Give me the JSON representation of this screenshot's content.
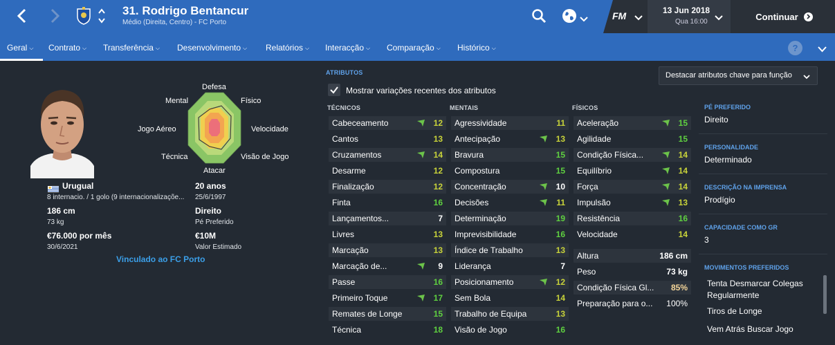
{
  "header": {
    "player_title": "31. Rodrigo Bentancur",
    "player_subtitle": "Médio (Direita, Centro) - FC Porto",
    "fm_logo": "FM",
    "date": "13 Jun 2018",
    "day_time": "Qua 16:00",
    "continue_label": "Continuar",
    "icons": [
      "back-arrow-icon",
      "forward-arrow-icon",
      "club-crest-icon",
      "up-down-chevron-icon",
      "search-icon",
      "globe-icon",
      "chevron-down-icon",
      "continue-arrow-icon"
    ]
  },
  "tabs": [
    {
      "label": "Geral"
    },
    {
      "label": "Contrato"
    },
    {
      "label": "Transferência"
    },
    {
      "label": "Desenvolvimento"
    },
    {
      "label": "Relatórios"
    },
    {
      "label": "Interacção"
    },
    {
      "label": "Comparação"
    },
    {
      "label": "Histórico"
    }
  ],
  "help_label": "?",
  "radar": {
    "labels": [
      "Defesa",
      "Mental",
      "Físico",
      "Jogo Aéreo",
      "Velocidade",
      "Técnica",
      "Visão de Jogo",
      "Atacar"
    ]
  },
  "profile": {
    "nation": "Urugual",
    "caps": "8 internacio. / 1 golo (9 internacionalizaçõe...",
    "age": "20 anos",
    "birth": "25/6/1997",
    "height": "186 cm",
    "weight": "73 kg",
    "foot": "Direito",
    "foot_label": "Pé Preferido",
    "wage": "€76.000 por mês",
    "contract_end": "30/6/2021",
    "value": "€10M",
    "value_label": "Valor Estimado",
    "club_link": "Vinculado ao FC Porto"
  },
  "attributes": {
    "section_title": "ATRIBUTOS",
    "highlight_dropdown": "Destacar atributos chave para função",
    "show_changes_label": "Mostrar variações recentes dos atributos",
    "technical_title": "TÉCNICOS",
    "mental_title": "MENTAIS",
    "physical_title": "FÍSICOS",
    "technical": [
      {
        "name": "Cabeceamento",
        "value": "12",
        "up": true
      },
      {
        "name": "Cantos",
        "value": "13",
        "up": false
      },
      {
        "name": "Cruzamentos",
        "value": "14",
        "up": true
      },
      {
        "name": "Desarme",
        "value": "12",
        "up": false
      },
      {
        "name": "Finalização",
        "value": "12",
        "up": false
      },
      {
        "name": "Finta",
        "value": "16",
        "up": false
      },
      {
        "name": "Lançamentos...",
        "value": "7",
        "up": false
      },
      {
        "name": "Livres",
        "value": "13",
        "up": false
      },
      {
        "name": "Marcação",
        "value": "13",
        "up": false
      },
      {
        "name": "Marcação de...",
        "value": "9",
        "up": true
      },
      {
        "name": "Passe",
        "value": "16",
        "up": false
      },
      {
        "name": "Primeiro Toque",
        "value": "17",
        "up": true
      },
      {
        "name": "Remates de Longe",
        "value": "15",
        "up": false
      },
      {
        "name": "Técnica",
        "value": "18",
        "up": false
      }
    ],
    "mental": [
      {
        "name": "Agressividade",
        "value": "11",
        "up": false
      },
      {
        "name": "Antecipação",
        "value": "13",
        "up": true
      },
      {
        "name": "Bravura",
        "value": "15",
        "up": false
      },
      {
        "name": "Compostura",
        "value": "15",
        "up": false
      },
      {
        "name": "Concentração",
        "value": "10",
        "up": true
      },
      {
        "name": "Decisões",
        "value": "11",
        "up": true
      },
      {
        "name": "Determinação",
        "value": "19",
        "up": false
      },
      {
        "name": "Imprevisibilidade",
        "value": "16",
        "up": false
      },
      {
        "name": "Índice de Trabalho",
        "value": "13",
        "up": false
      },
      {
        "name": "Liderança",
        "value": "7",
        "up": false
      },
      {
        "name": "Posicionamento",
        "value": "12",
        "up": true
      },
      {
        "name": "Sem Bola",
        "value": "14",
        "up": false
      },
      {
        "name": "Trabalho de Equipa",
        "value": "13",
        "up": false
      },
      {
        "name": "Visão de Jogo",
        "value": "16",
        "up": false
      }
    ],
    "physical": [
      {
        "name": "Aceleração",
        "value": "15",
        "up": true
      },
      {
        "name": "Agilidade",
        "value": "15",
        "up": false
      },
      {
        "name": "Condição Física...",
        "value": "14",
        "up": true
      },
      {
        "name": "Equilíbrio",
        "value": "14",
        "up": true
      },
      {
        "name": "Força",
        "value": "14",
        "up": true
      },
      {
        "name": "Impulsão",
        "value": "13",
        "up": true
      },
      {
        "name": "Resistência",
        "value": "16",
        "up": false
      },
      {
        "name": "Velocidade",
        "value": "14",
        "up": false
      }
    ],
    "physical_stats": [
      {
        "name": "Altura",
        "value": "186 cm"
      },
      {
        "name": "Peso",
        "value": "73 kg"
      },
      {
        "name": "Condição Física Gl...",
        "value": "85%"
      },
      {
        "name": "Preparação para o...",
        "value": "100%"
      }
    ]
  },
  "side": {
    "foot_title": "PÉ PREFERIDO",
    "foot_value": "Direito",
    "personality_title": "PERSONALIDADE",
    "personality_value": "Determinado",
    "press_title": "DESCRIÇÃO NA IMPRENSA",
    "press_value": "Prodígio",
    "gk_title": "CAPACIDADE COMO GR",
    "gk_value": "3",
    "moves_title": "MOVIMENTOS PREFERIDOS",
    "moves": [
      "Tenta Desmarcar Colegas Regularmente",
      "Tiros de Longe",
      "Vem Atrás Buscar Jogo"
    ]
  },
  "colors": {
    "accent": "#2f6bbd",
    "background": "#232a33",
    "value_green": "#5fd040",
    "value_yellow": "#c8d33a",
    "link": "#3b9fe8"
  }
}
